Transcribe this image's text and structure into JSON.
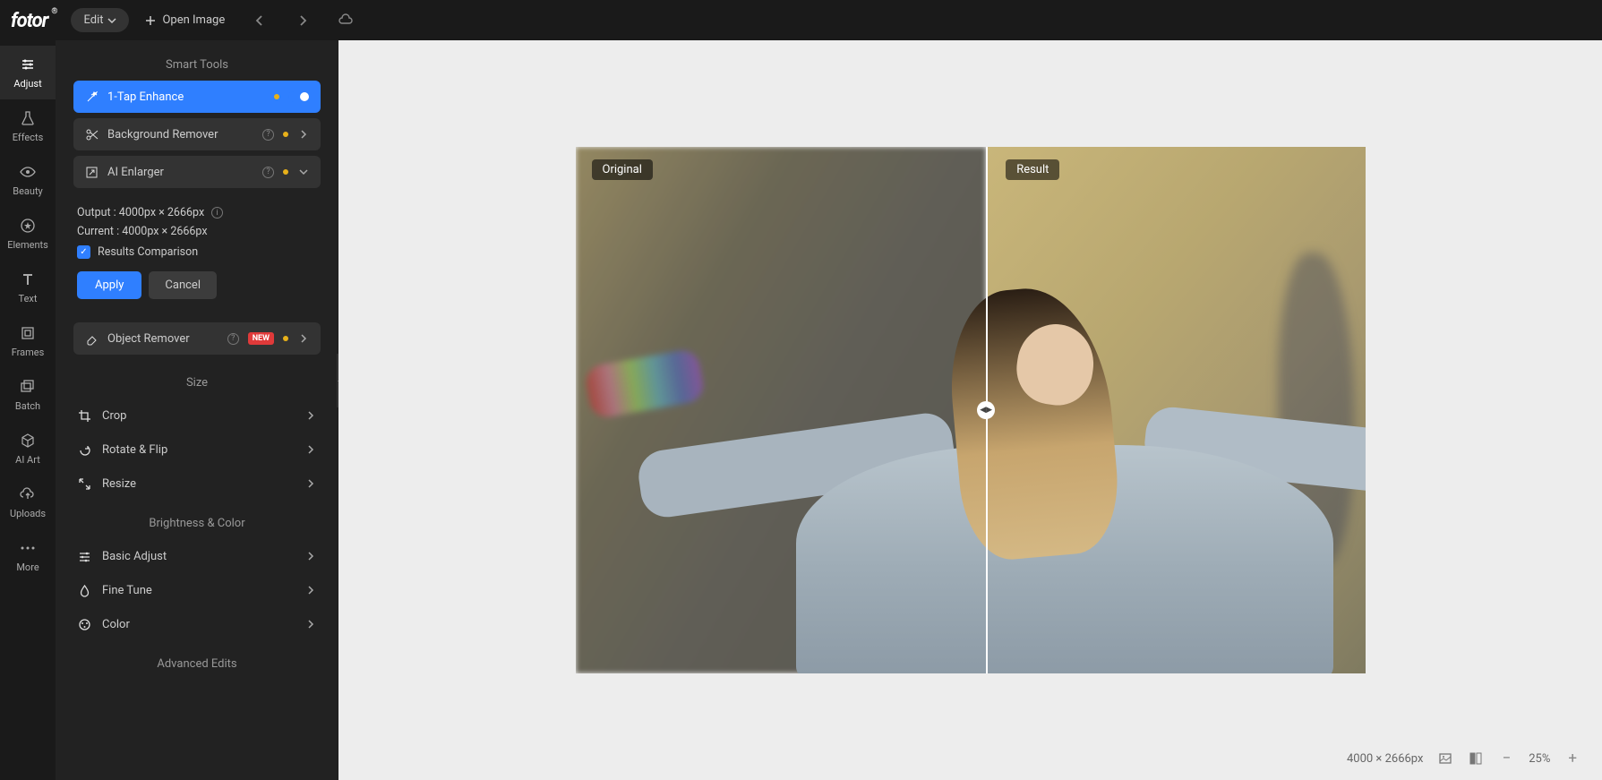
{
  "header": {
    "logo": "fotor",
    "edit_label": "Edit",
    "open_label": "Open Image"
  },
  "sidebar": {
    "items": [
      {
        "label": "Adjust"
      },
      {
        "label": "Effects"
      },
      {
        "label": "Beauty"
      },
      {
        "label": "Elements"
      },
      {
        "label": "Text"
      },
      {
        "label": "Frames"
      },
      {
        "label": "Batch"
      },
      {
        "label": "AI Art"
      },
      {
        "label": "Uploads"
      },
      {
        "label": "More"
      }
    ]
  },
  "panel": {
    "smart_tools_title": "Smart Tools",
    "one_tap_label": "1-Tap Enhance",
    "bg_remover_label": "Background Remover",
    "ai_enlarger_label": "AI Enlarger",
    "output_label": "Output : 4000px × 2666px",
    "current_label": "Current : 4000px × 2666px",
    "results_comparison_label": "Results Comparison",
    "apply_label": "Apply",
    "cancel_label": "Cancel",
    "object_remover_label": "Object Remover",
    "new_badge": "NEW",
    "size_title": "Size",
    "crop_label": "Crop",
    "rotate_label": "Rotate & Flip",
    "resize_label": "Resize",
    "brightness_title": "Brightness & Color",
    "basic_adjust_label": "Basic Adjust",
    "fine_tune_label": "Fine Tune",
    "color_label": "Color",
    "advanced_title": "Advanced Edits"
  },
  "canvas": {
    "original_label": "Original",
    "result_label": "Result"
  },
  "footer": {
    "dimensions": "4000 × 2666px",
    "zoom": "25%"
  }
}
